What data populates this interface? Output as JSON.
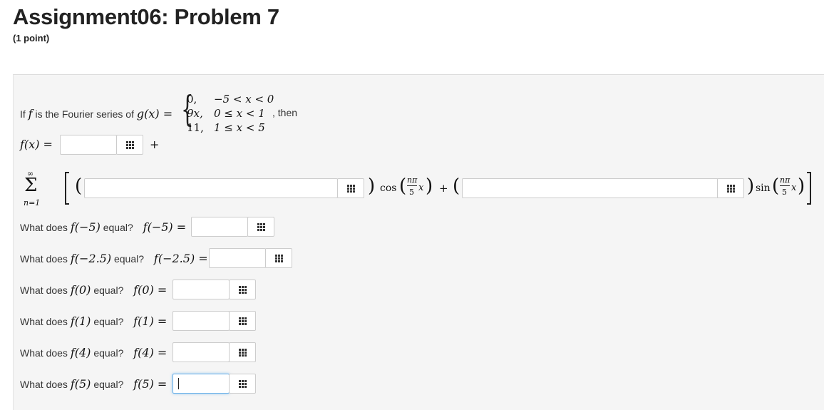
{
  "header": {
    "title": "Assignment06: Problem 7",
    "points": "(1 point)"
  },
  "statement": {
    "prefix": "If",
    "f_var": "f",
    "middle": "is the Fourier series of",
    "g_expr": "g(x) =",
    "cases": [
      {
        "value": "0,",
        "condition": "−5 < x < 0"
      },
      {
        "value": "9x,",
        "condition": "0 ≤ x < 1"
      },
      {
        "value": "11,",
        "condition": "1 ≤ x < 5"
      }
    ],
    "suffix": ", then"
  },
  "series": {
    "f_label": "f(x) =",
    "plus": "+",
    "sum_upper": "∞",
    "sum_symbol": "Σ",
    "sum_lower": "n=1",
    "cos_label": "cos",
    "sin_label": "sin",
    "arg_numerator": "nπ",
    "arg_denominator": "5",
    "arg_var": "x",
    "plus_mid": "+"
  },
  "inputs": {
    "a0": "",
    "an": "",
    "bn": ""
  },
  "questions": [
    {
      "label": "What does",
      "fx": "f(−5)",
      "tail": "equal?",
      "eq": "f(−5) =",
      "value": ""
    },
    {
      "label": "What does",
      "fx": "f(−2.5)",
      "tail": "equal?",
      "eq": "f(−2.5) =",
      "value": ""
    },
    {
      "label": "What does",
      "fx": "f(0)",
      "tail": "equal?",
      "eq": "f(0) =",
      "value": ""
    },
    {
      "label": "What does",
      "fx": "f(1)",
      "tail": "equal?",
      "eq": "f(1) =",
      "value": ""
    },
    {
      "label": "What does",
      "fx": "f(4)",
      "tail": "equal?",
      "eq": "f(4) =",
      "value": ""
    },
    {
      "label": "What does",
      "fx": "f(5)",
      "tail": "equal?",
      "eq": "f(5) =",
      "value": ""
    }
  ],
  "icons": {
    "equation_editor": "grid-icon"
  },
  "colors": {
    "focus_border": "#66afe9",
    "panel_bg": "#f5f5f5"
  }
}
